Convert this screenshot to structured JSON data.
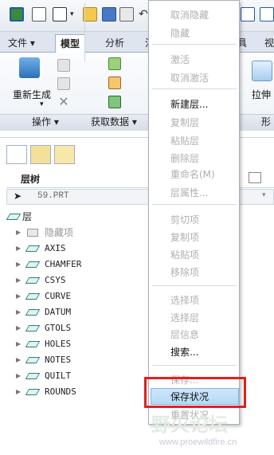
{
  "ribbon_tabs": [
    "文件 ▾",
    "模型",
    "分析",
    "注",
    "具",
    "视"
  ],
  "ribbon": {
    "regen_label": "重新生成",
    "regen_arrow": "▾",
    "ops_group": "操作 ▾",
    "getdata_group": "获取数据 ▾",
    "pull_label": "拉伸",
    "shape_group": "形"
  },
  "panel": {
    "tree_title": "层树",
    "path_value": "59.PRT",
    "root_label": "层",
    "rows": [
      {
        "label": "隐藏项",
        "hidden": true
      },
      {
        "label": "AXIS"
      },
      {
        "label": "CHAMFER"
      },
      {
        "label": "CSYS"
      },
      {
        "label": "CURVE"
      },
      {
        "label": "DATUM"
      },
      {
        "label": "GTOLS"
      },
      {
        "label": "HOLES"
      },
      {
        "label": "NOTES"
      },
      {
        "label": "QUILT"
      },
      {
        "label": "ROUNDS"
      }
    ]
  },
  "context_menu": {
    "items": [
      {
        "label": "取消隐藏",
        "enabled": false
      },
      {
        "label": "隐藏",
        "enabled": false
      },
      {
        "label": "激活",
        "enabled": false
      },
      {
        "label": "取消激活",
        "enabled": false
      },
      {
        "label": "新建层...",
        "enabled": true
      },
      {
        "label": "复制层",
        "enabled": false
      },
      {
        "label": "粘贴层",
        "enabled": false
      },
      {
        "label": "删除层",
        "enabled": false
      },
      {
        "label": "重命名(M)",
        "enabled": false
      },
      {
        "label": "层属性...",
        "enabled": false
      },
      {
        "label": "剪切项",
        "enabled": false
      },
      {
        "label": "复制项",
        "enabled": false
      },
      {
        "label": "粘贴项",
        "enabled": false
      },
      {
        "label": "移除项",
        "enabled": false
      },
      {
        "label": "选择项",
        "enabled": false
      },
      {
        "label": "选择层",
        "enabled": false
      },
      {
        "label": "层信息",
        "enabled": false
      },
      {
        "label": "搜索...",
        "enabled": true
      },
      {
        "label": "保存...",
        "enabled": false
      },
      {
        "label": "保存状况",
        "enabled": true,
        "highlighted": true
      },
      {
        "label": "重置状况",
        "enabled": false
      }
    ]
  },
  "watermark": {
    "text": "野火论坛",
    "url": "www.proewildfire.cn"
  },
  "colors": {
    "highlight": "#b6d8f6",
    "annotation_box": "#e0201e",
    "layer_icon": "#2f7d7d"
  }
}
